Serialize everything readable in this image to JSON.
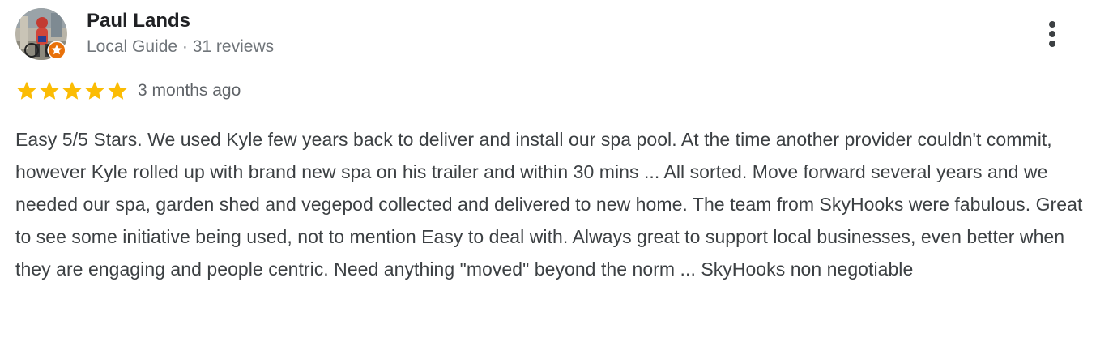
{
  "reviewer": {
    "name": "Paul Lands",
    "meta": "Local Guide · 31 reviews",
    "avatar_icon": "reviewer-photo",
    "badge_icon": "local-guide-star-icon"
  },
  "rating": {
    "stars": 5,
    "max_stars": 5,
    "star_color": "#fbbc04",
    "date": "3 months ago"
  },
  "review": {
    "text": "Easy 5/5 Stars. We used Kyle few years back to deliver and install our spa pool. At the time another provider couldn't commit, however Kyle rolled up with brand new spa on his trailer and within 30 mins ... All sorted. Move forward several years and we needed our spa, garden shed and vegepod collected and delivered to new home. The team from SkyHooks were fabulous. Great to see some initiative being used, not to mention Easy to deal with. Always great to support local businesses, even better when they are engaging and people centric. Need anything \"moved\" beyond the norm ... SkyHooks non negotiable"
  },
  "menu": {
    "icon": "more-vertical-icon"
  },
  "colors": {
    "name": "#202124",
    "meta": "#70757a",
    "body_text": "#3c4043",
    "badge": "#e8710a"
  }
}
